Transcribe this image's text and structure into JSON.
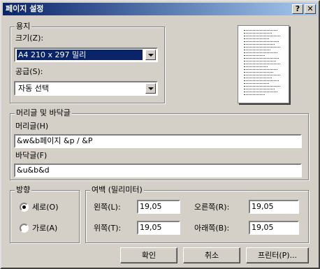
{
  "dialog": {
    "title": "페이지 설정",
    "help_label": "?",
    "close_label": "✕"
  },
  "paper": {
    "group_label": "용지",
    "size_label": "크기(Z):",
    "size_value": "A4 210 x 297 밀리",
    "source_label": "공급(S):",
    "source_value": "자동 선택"
  },
  "header_footer": {
    "group_label": "머리글 및 바닥글",
    "header_label": "머리글(H)",
    "header_value": "&w&b페이지 &p / &P",
    "footer_label": "바닥글(F)",
    "footer_value": "&u&b&d"
  },
  "orientation": {
    "group_label": "방향",
    "portrait_label": "세로(O)",
    "landscape_label": "가로(A)",
    "selected": "portrait"
  },
  "margins": {
    "group_label": "여백 (밀리미터)",
    "left_label": "왼쪽(L):",
    "left_value": "19,05",
    "right_label": "오른쪽(R):",
    "right_value": "19,05",
    "top_label": "위쪽(T):",
    "top_value": "19,05",
    "bottom_label": "아래쪽(B):",
    "bottom_value": "19,05"
  },
  "buttons": {
    "ok": "확인",
    "cancel": "취소",
    "printer": "프린터(P)..."
  }
}
